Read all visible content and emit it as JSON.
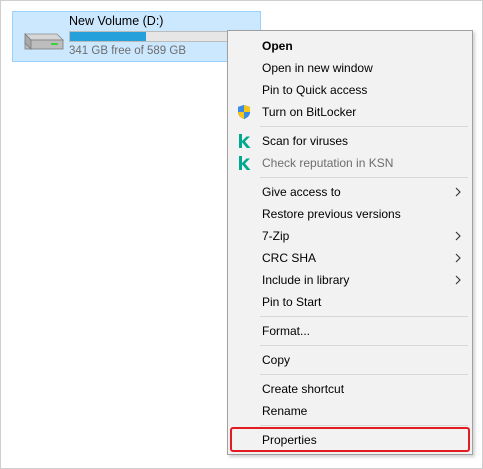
{
  "drive": {
    "name": "New Volume (D:)",
    "space_text": "341 GB free of 589 GB",
    "used_fraction": 0.42,
    "bar_color": "#26a0da",
    "icon": "hard-drive-icon"
  },
  "context_menu": {
    "items": [
      {
        "label": "Open",
        "bold": true
      },
      {
        "label": "Open in new window"
      },
      {
        "label": "Pin to Quick access"
      },
      {
        "label": "Turn on BitLocker",
        "icon": "uac-shield-icon"
      },
      {
        "label": "Scan for viruses",
        "icon": "kaspersky-icon"
      },
      {
        "label": "Check reputation in KSN",
        "icon": "kaspersky-icon",
        "disabled": true
      },
      {
        "label": "Give access to",
        "submenu": true
      },
      {
        "label": "Restore previous versions"
      },
      {
        "label": "7-Zip",
        "submenu": true
      },
      {
        "label": "CRC SHA",
        "submenu": true
      },
      {
        "label": "Include in library",
        "submenu": true
      },
      {
        "label": "Pin to Start"
      },
      {
        "label": "Format..."
      },
      {
        "label": "Copy"
      },
      {
        "label": "Create shortcut"
      },
      {
        "label": "Rename"
      },
      {
        "label": "Properties",
        "highlighted": true
      }
    ],
    "highlight_color": "#e31b23",
    "kaspersky_color": "#00a88e"
  }
}
